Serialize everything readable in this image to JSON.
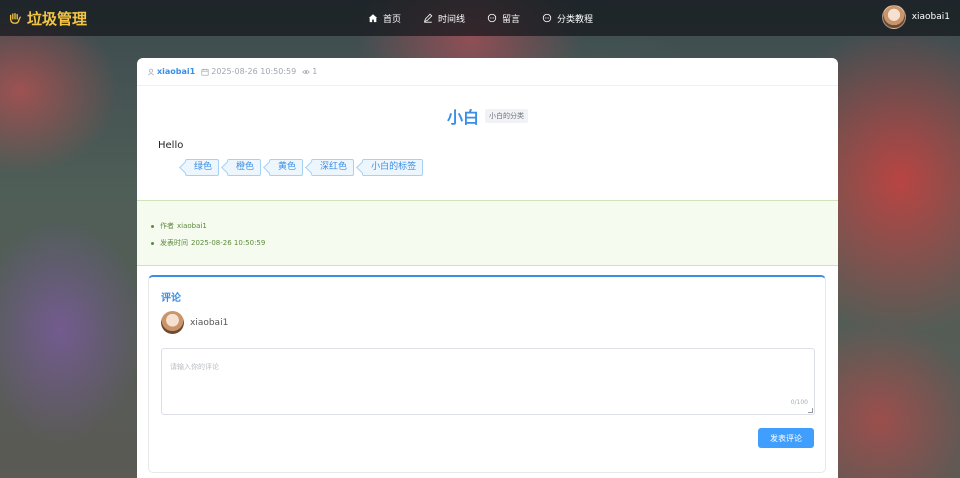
{
  "brand": {
    "title": "垃圾管理",
    "icon": "hand-icon"
  },
  "nav": {
    "items": [
      {
        "label": "首页",
        "icon": "home-icon"
      },
      {
        "label": "时间线",
        "icon": "pen-icon"
      },
      {
        "label": "留言",
        "icon": "chat-icon"
      },
      {
        "label": "分类教程",
        "icon": "chat-icon"
      }
    ]
  },
  "user": {
    "name": "xiaobai1"
  },
  "post": {
    "author": "xiaobai1",
    "datetime": "2025-08-26 10:50:59",
    "views": "1",
    "title": "小白",
    "category": "小白的分类",
    "content": "Hello",
    "tags": [
      "绿色",
      "橙色",
      "黄色",
      "深红色",
      "小白的标签"
    ]
  },
  "info": {
    "author_label": "作者",
    "author_value": "xiaobai1",
    "time_label": "发表时间",
    "time_value": "2025-08-26 10:50:59"
  },
  "comments": {
    "title": "评论",
    "user": "xiaobai1",
    "placeholder": "请输入你的评论",
    "counter": "0/100",
    "submit_label": "发表评论"
  },
  "colors": {
    "accent": "#3a8ee6",
    "brand": "#f4c542",
    "info_text": "#5d8a3b",
    "button": "#409eff"
  }
}
